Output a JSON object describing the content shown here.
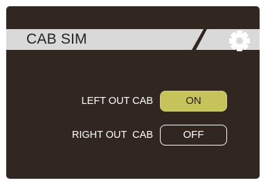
{
  "header": {
    "title": "CAB SIM",
    "settings_icon": "gear-icon"
  },
  "settings": [
    {
      "label": "LEFT OUT CAB",
      "value": "ON",
      "state": "on"
    },
    {
      "label": "RIGHT OUT  CAB",
      "value": "OFF",
      "state": "off"
    }
  ],
  "colors": {
    "screen_bg": "#322621",
    "header_band": "#d9d9d9",
    "on_toggle": "#c6c35a"
  }
}
